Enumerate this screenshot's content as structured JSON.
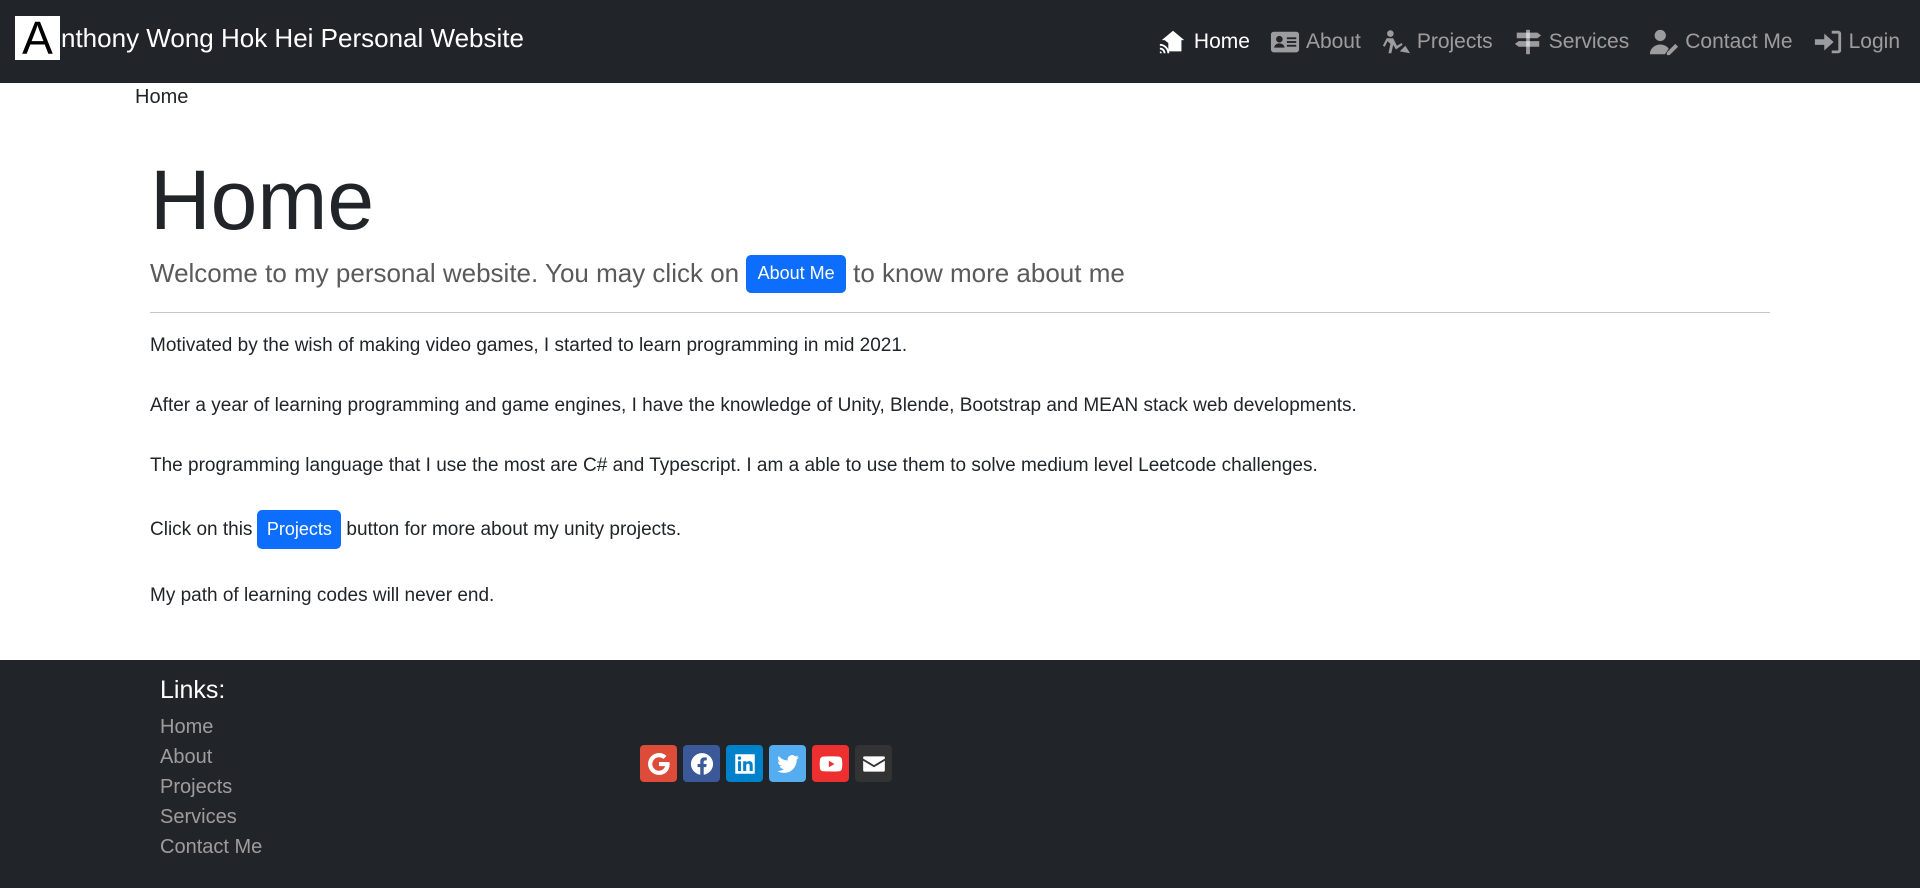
{
  "brand": {
    "logo_letter": "A",
    "text": "nthony Wong Hok Hei Personal Website"
  },
  "nav": {
    "items": [
      {
        "label": "Home",
        "icon": "house-signal-icon",
        "active": true
      },
      {
        "label": "About",
        "icon": "address-card-icon",
        "active": false
      },
      {
        "label": "Projects",
        "icon": "person-digging-icon",
        "active": false
      },
      {
        "label": "Services",
        "icon": "signs-post-icon",
        "active": false
      },
      {
        "label": "Contact Me",
        "icon": "user-pen-icon",
        "active": false
      },
      {
        "label": "Login",
        "icon": "right-to-bracket-icon",
        "active": false
      }
    ]
  },
  "breadcrumb": {
    "current": "Home"
  },
  "main": {
    "title": "Home",
    "lead_before": "Welcome to my personal website. You may click on",
    "about_button": "About Me",
    "lead_after": "to know more about me",
    "paragraphs": [
      "Motivated by the wish of making video games, I started to learn programming in mid 2021.",
      "After a year of learning programming and game engines, I have the knowledge of Unity, Blende, Bootstrap and MEAN stack web developments.",
      "The programming language that I use the most are C# and Typescript. I am a able to use them to solve medium level Leetcode challenges."
    ],
    "projects_before": "Click on this",
    "projects_button": "Projects",
    "projects_after": "button for more about my unity projects.",
    "closing": "My path of learning codes will never end."
  },
  "footer": {
    "links_title": "Links:",
    "links": [
      "Home",
      "About",
      "Projects",
      "Services",
      "Contact Me"
    ],
    "social": [
      {
        "name": "google-icon",
        "color": "#dd4b39"
      },
      {
        "name": "facebook-icon",
        "color": "#3b5998"
      },
      {
        "name": "linkedin-icon",
        "color": "#0082ca"
      },
      {
        "name": "twitter-icon",
        "color": "#55acee"
      },
      {
        "name": "youtube-icon",
        "color": "#ed302f"
      },
      {
        "name": "email-icon",
        "color": "#333333"
      }
    ]
  },
  "colors": {
    "navbar_bg": "#212529",
    "primary": "#0d6efd"
  }
}
